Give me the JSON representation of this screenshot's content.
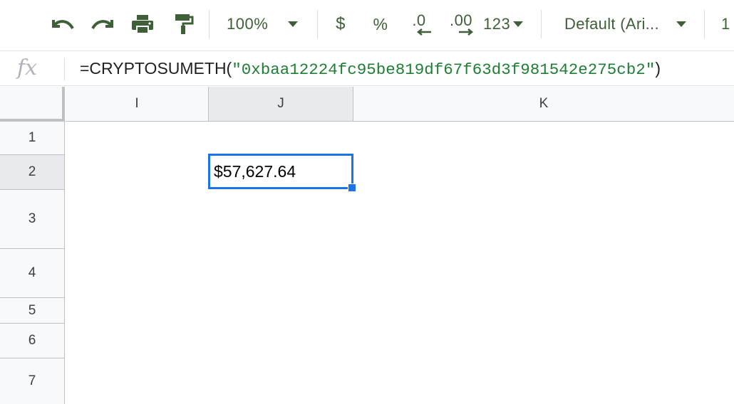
{
  "toolbar": {
    "undo_icon": "undo-icon",
    "redo_icon": "redo-icon",
    "print_icon": "print-icon",
    "paint_format_icon": "paint-format-icon",
    "zoom": "100%",
    "currency": "$",
    "percent": "%",
    "decrease_decimal": ".0",
    "increase_decimal": ".00",
    "more_formats": "123",
    "font": "Default (Ari...",
    "font_size_partial": "1",
    "accent_color": "#3e5f37"
  },
  "formula_bar": {
    "fx_label": "fx",
    "formula_prefix": "=CRYPTOSUMETH(",
    "formula_string": "\"0xbaa12224fc95be819df67f63d3f981542e275cb2\"",
    "formula_suffix": ")"
  },
  "columns": [
    "I",
    "J",
    "K"
  ],
  "rows": [
    "1",
    "2",
    "3",
    "4",
    "5",
    "6",
    "7"
  ],
  "active_cell": {
    "column": "J",
    "row": "2",
    "value": "$57,627.64",
    "border_color": "#1a73e8"
  }
}
